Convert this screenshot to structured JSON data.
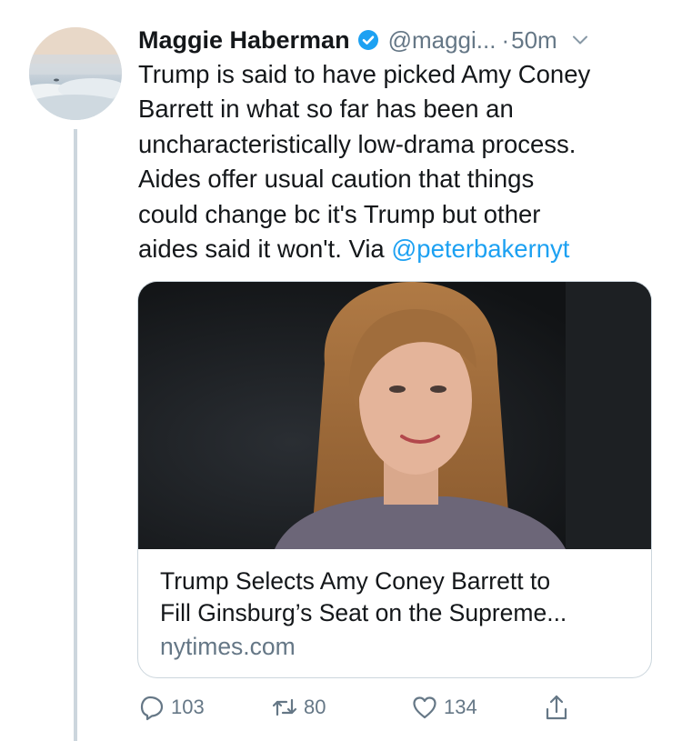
{
  "tweet": {
    "author_name": "Maggie Haberman",
    "handle": "@maggi...",
    "separator": "·",
    "time": "50m",
    "text_lines": [
      "Trump is said to have picked Amy Coney",
      "Barrett in what so far has been an",
      "uncharacteristically low-drama process.",
      "Aides offer usual caution that things",
      "could change bc it's Trump but other",
      "aides said it won't. Via "
    ],
    "mention": "@peterbakernyt"
  },
  "icons": {
    "verified": "verified-badge-icon",
    "chevron": "chevron-down-icon",
    "reply": "reply-icon",
    "retweet": "retweet-icon",
    "like": "heart-icon",
    "share": "share-icon"
  },
  "card": {
    "title_lines": [
      "Trump Selects Amy Coney Barrett to",
      "Fill Ginsburg’s Seat on the Supreme..."
    ],
    "domain": "nytimes.com"
  },
  "actions": {
    "replies": "103",
    "retweets": "80",
    "likes": "134"
  },
  "colors": {
    "accent": "#1da1f2",
    "secondary_text": "#657786",
    "primary_text": "#14171a",
    "divider": "#ccd6dd"
  }
}
